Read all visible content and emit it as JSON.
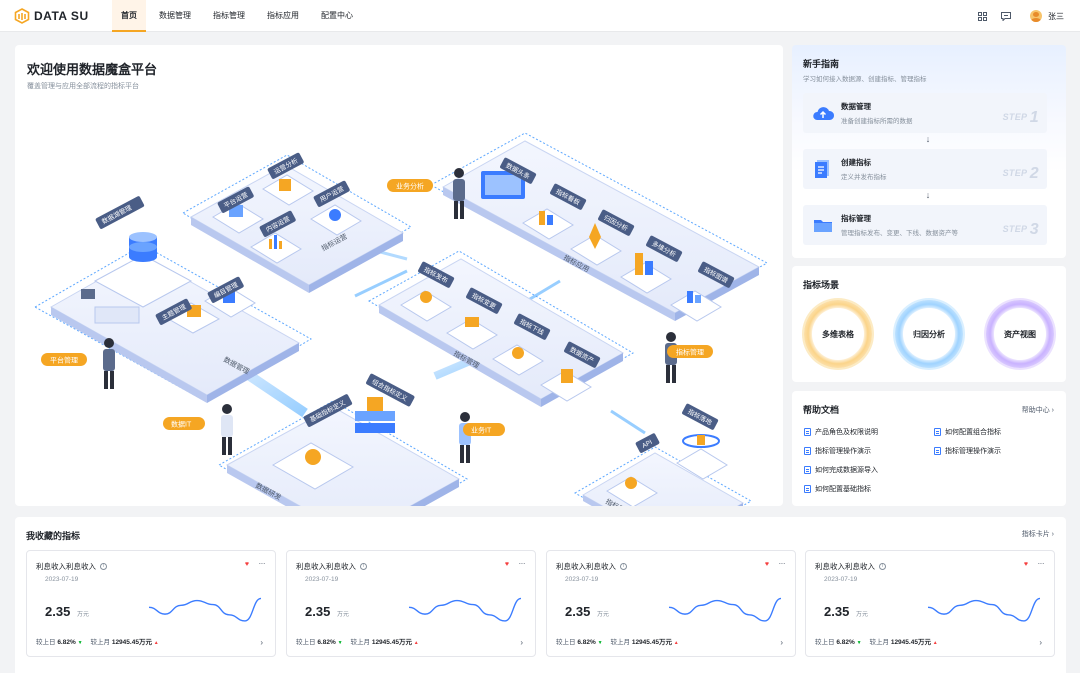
{
  "header": {
    "logo_text": "DATA SU",
    "nav": [
      {
        "label": "首页",
        "active": true
      },
      {
        "label": "数据管理",
        "active": false
      },
      {
        "label": "指标管理",
        "active": false
      },
      {
        "label": "指标应用",
        "active": false
      },
      {
        "label": "配置中心",
        "active": false
      }
    ],
    "icons": [
      "grid-icon",
      "message-icon"
    ],
    "user_name": "张三"
  },
  "welcome": {
    "title": "欢迎使用数据魔盒平台",
    "subtitle": "覆盖管理与应用全部流程的指标平台",
    "illustration": {
      "zones": {
        "data_mgmt": "数据管理",
        "metric_ops": "指标运营",
        "metric_app": "指标应用",
        "metric_mgmt": "指标管理",
        "data_dev": "数据研发",
        "metric_service": "指标服务"
      },
      "tags": {
        "lake": "数据湖管理",
        "theme": "主题管理",
        "catalog": "编目管理",
        "platform_ops": "平台运营",
        "ops_analysis": "运营分析",
        "user_ops": "用户运营",
        "content_ops": "内容运营",
        "data_headline": "数据头条",
        "dashboard": "指标看板",
        "attribution": "归因分析",
        "multi_dim": "多维分析",
        "metric_graph": "指标图谱",
        "publish": "指标发布",
        "change": "指标变更",
        "offline": "指标下线",
        "asset": "数据资产",
        "combo_def": "组合指标定义",
        "base_def": "基础指标定义",
        "landing": "指标落地",
        "api": "API"
      },
      "roles": {
        "business_analysis": "业务分析",
        "platform_mgmt": "平台管理",
        "metric_mgmt": "指标管理",
        "data_it": "数据IT",
        "business_it": "业务IT"
      }
    }
  },
  "guide": {
    "title": "新手指南",
    "subtitle": "学习如何接入数据源、创建指标、管理指标",
    "steps": [
      {
        "name": "数据管理",
        "desc": "准备创建指标所需的数据",
        "num_label": "STEP",
        "num": "1"
      },
      {
        "name": "创建指标",
        "desc": "定义并发布指标",
        "num_label": "STEP",
        "num": "2"
      },
      {
        "name": "指标管理",
        "desc": "管理指标发布、变更、下线、数据资产等",
        "num_label": "STEP",
        "num": "3"
      }
    ]
  },
  "scenes": {
    "title": "指标场景",
    "items": [
      "多维表格",
      "归因分析",
      "资产视图"
    ]
  },
  "help": {
    "title": "帮助文档",
    "more": "帮助中心",
    "docs_left": [
      "产品角色及权限说明",
      "指标管理操作演示",
      "如何完成数据源导入",
      "如何配置基础指标"
    ],
    "docs_right": [
      "如何配置组合指标",
      "指标管理操作演示"
    ]
  },
  "favorites": {
    "title": "我收藏的指标",
    "more": "指标卡片",
    "cards": [
      {
        "name": "利息收入利息收入",
        "date": "2023-07-19",
        "value": "2.35",
        "unit": "万元",
        "day_label": "较上日",
        "day_value": "6.82%",
        "month_label": "较上月",
        "month_value": "12945.45万元",
        "spark": [
          0.52,
          0.32,
          0.58,
          0.72,
          0.6,
          0.3,
          0.12,
          0.78
        ]
      },
      {
        "name": "利息收入利息收入",
        "date": "2023-07-19",
        "value": "2.35",
        "unit": "万元",
        "day_label": "较上日",
        "day_value": "6.82%",
        "month_label": "较上月",
        "month_value": "12945.45万元",
        "spark": [
          0.52,
          0.32,
          0.58,
          0.72,
          0.6,
          0.3,
          0.12,
          0.78
        ]
      },
      {
        "name": "利息收入利息收入",
        "date": "2023-07-19",
        "value": "2.35",
        "unit": "万元",
        "day_label": "较上日",
        "day_value": "6.82%",
        "month_label": "较上月",
        "month_value": "12945.45万元",
        "spark": [
          0.52,
          0.32,
          0.58,
          0.72,
          0.6,
          0.3,
          0.12,
          0.78
        ]
      },
      {
        "name": "利息收入利息收入",
        "date": "2023-07-19",
        "value": "2.35",
        "unit": "万元",
        "day_label": "较上日",
        "day_value": "6.82%",
        "month_label": "较上月",
        "month_value": "12945.45万元",
        "spark": [
          0.52,
          0.32,
          0.58,
          0.72,
          0.6,
          0.3,
          0.12,
          0.78
        ]
      }
    ]
  },
  "colors": {
    "accent": "#f5a623",
    "primary_blue": "#3b7cff",
    "platform": "#e9eefb",
    "up": "#00b42a",
    "down": "#f53f3f"
  }
}
